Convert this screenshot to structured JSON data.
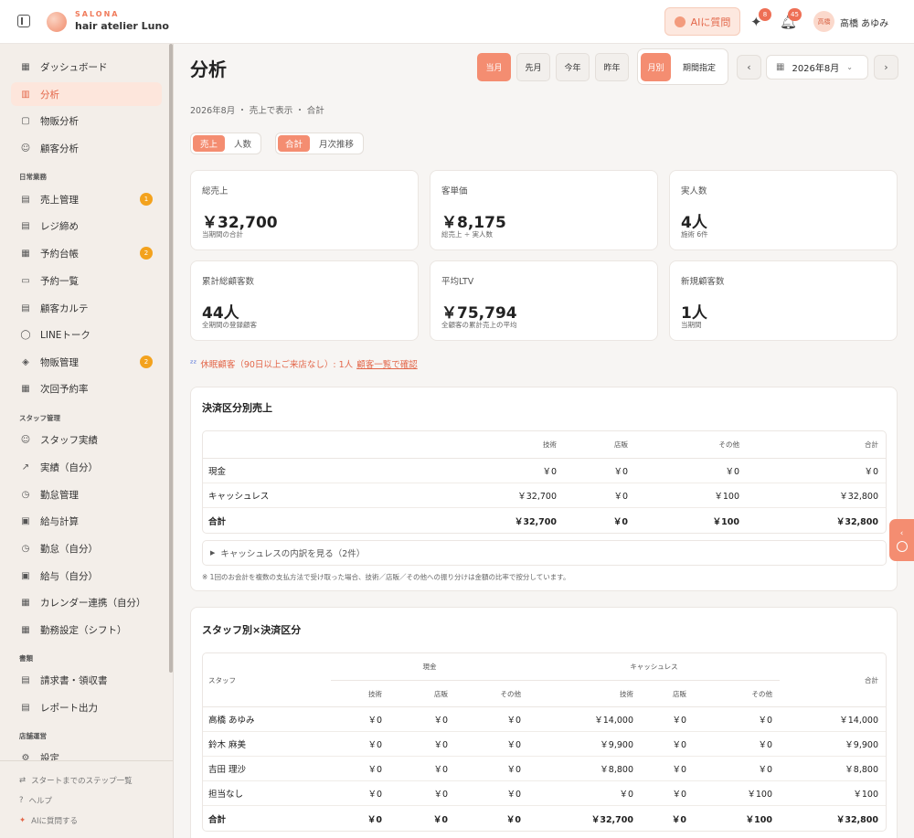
{
  "brand": {
    "sub": "SALONA",
    "name": "hair atelier Luno"
  },
  "header": {
    "ai_label": "AIに質問",
    "badge_sparkle": "8",
    "badge_bell": "45",
    "avatar_text": "高橋",
    "user_name": "高橋 あゆみ"
  },
  "sidebar": {
    "items": [
      {
        "label": "ダッシュボード",
        "icon": "grid-icon"
      },
      {
        "label": "分析",
        "icon": "bar-chart-icon"
      },
      {
        "label": "物販分析",
        "icon": "bag-icon"
      },
      {
        "label": "顧客分析",
        "icon": "users-icon"
      }
    ],
    "section_daily": "日常業務",
    "daily": [
      {
        "label": "売上管理",
        "badge": "1"
      },
      {
        "label": "レジ締め",
        "badge": ""
      },
      {
        "label": "予約台帳",
        "badge": "2"
      },
      {
        "label": "予約一覧",
        "badge": ""
      },
      {
        "label": "顧客カルテ",
        "badge": ""
      },
      {
        "label": "LINEトーク",
        "badge": ""
      },
      {
        "label": "物販管理",
        "badge": "2"
      },
      {
        "label": "次回予約率",
        "badge": ""
      }
    ],
    "section_staff": "スタッフ管理",
    "staff": [
      {
        "label": "スタッフ実績"
      },
      {
        "label": "実績（自分）"
      },
      {
        "label": "勤怠管理"
      },
      {
        "label": "給与計算"
      },
      {
        "label": "勤怠（自分）"
      },
      {
        "label": "給与（自分）"
      },
      {
        "label": "カレンダー連携（自分）"
      },
      {
        "label": "勤務設定（シフト）"
      }
    ],
    "section_docs": "書類",
    "docs": [
      {
        "label": "請求書・領収書"
      },
      {
        "label": "レポート出力"
      }
    ],
    "section_store": "店舗運営",
    "store": [
      {
        "label": "設定"
      }
    ],
    "footer": {
      "steps": "スタートまでのステップ一覧",
      "help": "ヘルプ",
      "ask_ai": "AIに質問する"
    }
  },
  "main": {
    "title": "分析",
    "period_buttons": [
      "当月",
      "先月",
      "今年",
      "昨年"
    ],
    "mode_buttons": [
      "月別",
      "期間指定"
    ],
    "month": "2026年8月",
    "subtitle": "2026年8月 ・ 売上で表示 ・ 合計",
    "toggle1": [
      "売上",
      "人数"
    ],
    "toggle2": [
      "合計",
      "月次推移"
    ],
    "kpis": [
      {
        "label": "総売上",
        "value": "￥32,700",
        "note": "当期間の合計"
      },
      {
        "label": "客単価",
        "value": "￥8,175",
        "note": "総売上 ÷ 実人数"
      },
      {
        "label": "実人数",
        "value": "4人",
        "note": "施術 6件"
      },
      {
        "label": "累計総顧客数",
        "value": "44人",
        "note": "全期間の登録顧客"
      },
      {
        "label": "平均LTV",
        "value": "￥75,794",
        "note": "全顧客の累計売上の平均"
      },
      {
        "label": "新規顧客数",
        "value": "1人",
        "note": "当期間"
      }
    ],
    "dormant": {
      "text": "休眠顧客（90日以上ご来店なし）: 1人",
      "link": "顧客一覧で確認"
    }
  },
  "payment_card": {
    "title": "決済区分別売上",
    "headers": [
      "",
      "技術",
      "店販",
      "その他",
      "合計"
    ],
    "rows": [
      [
        "現金",
        "￥0",
        "￥0",
        "￥0",
        "￥0"
      ],
      [
        "キャッシュレス",
        "￥32,700",
        "￥0",
        "￥100",
        "￥32,800"
      ],
      [
        "合計",
        "￥32,700",
        "￥0",
        "￥100",
        "￥32,800"
      ]
    ],
    "expand_label": "キャッシュレスの内訳を見る（2件）",
    "footnote": "※ 1回のお会計を複数の支払方法で受け取った場合、技術／店販／その他への振り分けは金額の比率で按分しています。"
  },
  "staff_card": {
    "title": "スタッフ別×決済区分",
    "h_staff": "スタッフ",
    "h_cash": "現金",
    "h_cashless": "キャッシュレス",
    "h_total": "合計",
    "sub": [
      "技術",
      "店販",
      "その他",
      "技術",
      "店販",
      "その他"
    ],
    "rows": [
      [
        "高橋 あゆみ",
        "￥0",
        "￥0",
        "￥0",
        "￥14,000",
        "￥0",
        "￥0",
        "￥14,000"
      ],
      [
        "鈴木 麻美",
        "￥0",
        "￥0",
        "￥0",
        "￥9,900",
        "￥0",
        "￥0",
        "￥9,900"
      ],
      [
        "吉田 理沙",
        "￥0",
        "￥0",
        "￥0",
        "￥8,800",
        "￥0",
        "￥0",
        "￥8,800"
      ],
      [
        "担当なし",
        "￥0",
        "￥0",
        "￥0",
        "￥0",
        "￥0",
        "￥100",
        "￥100"
      ],
      [
        "合計",
        "￥0",
        "￥0",
        "￥0",
        "￥32,700",
        "￥0",
        "￥100",
        "￥32,800"
      ]
    ]
  }
}
